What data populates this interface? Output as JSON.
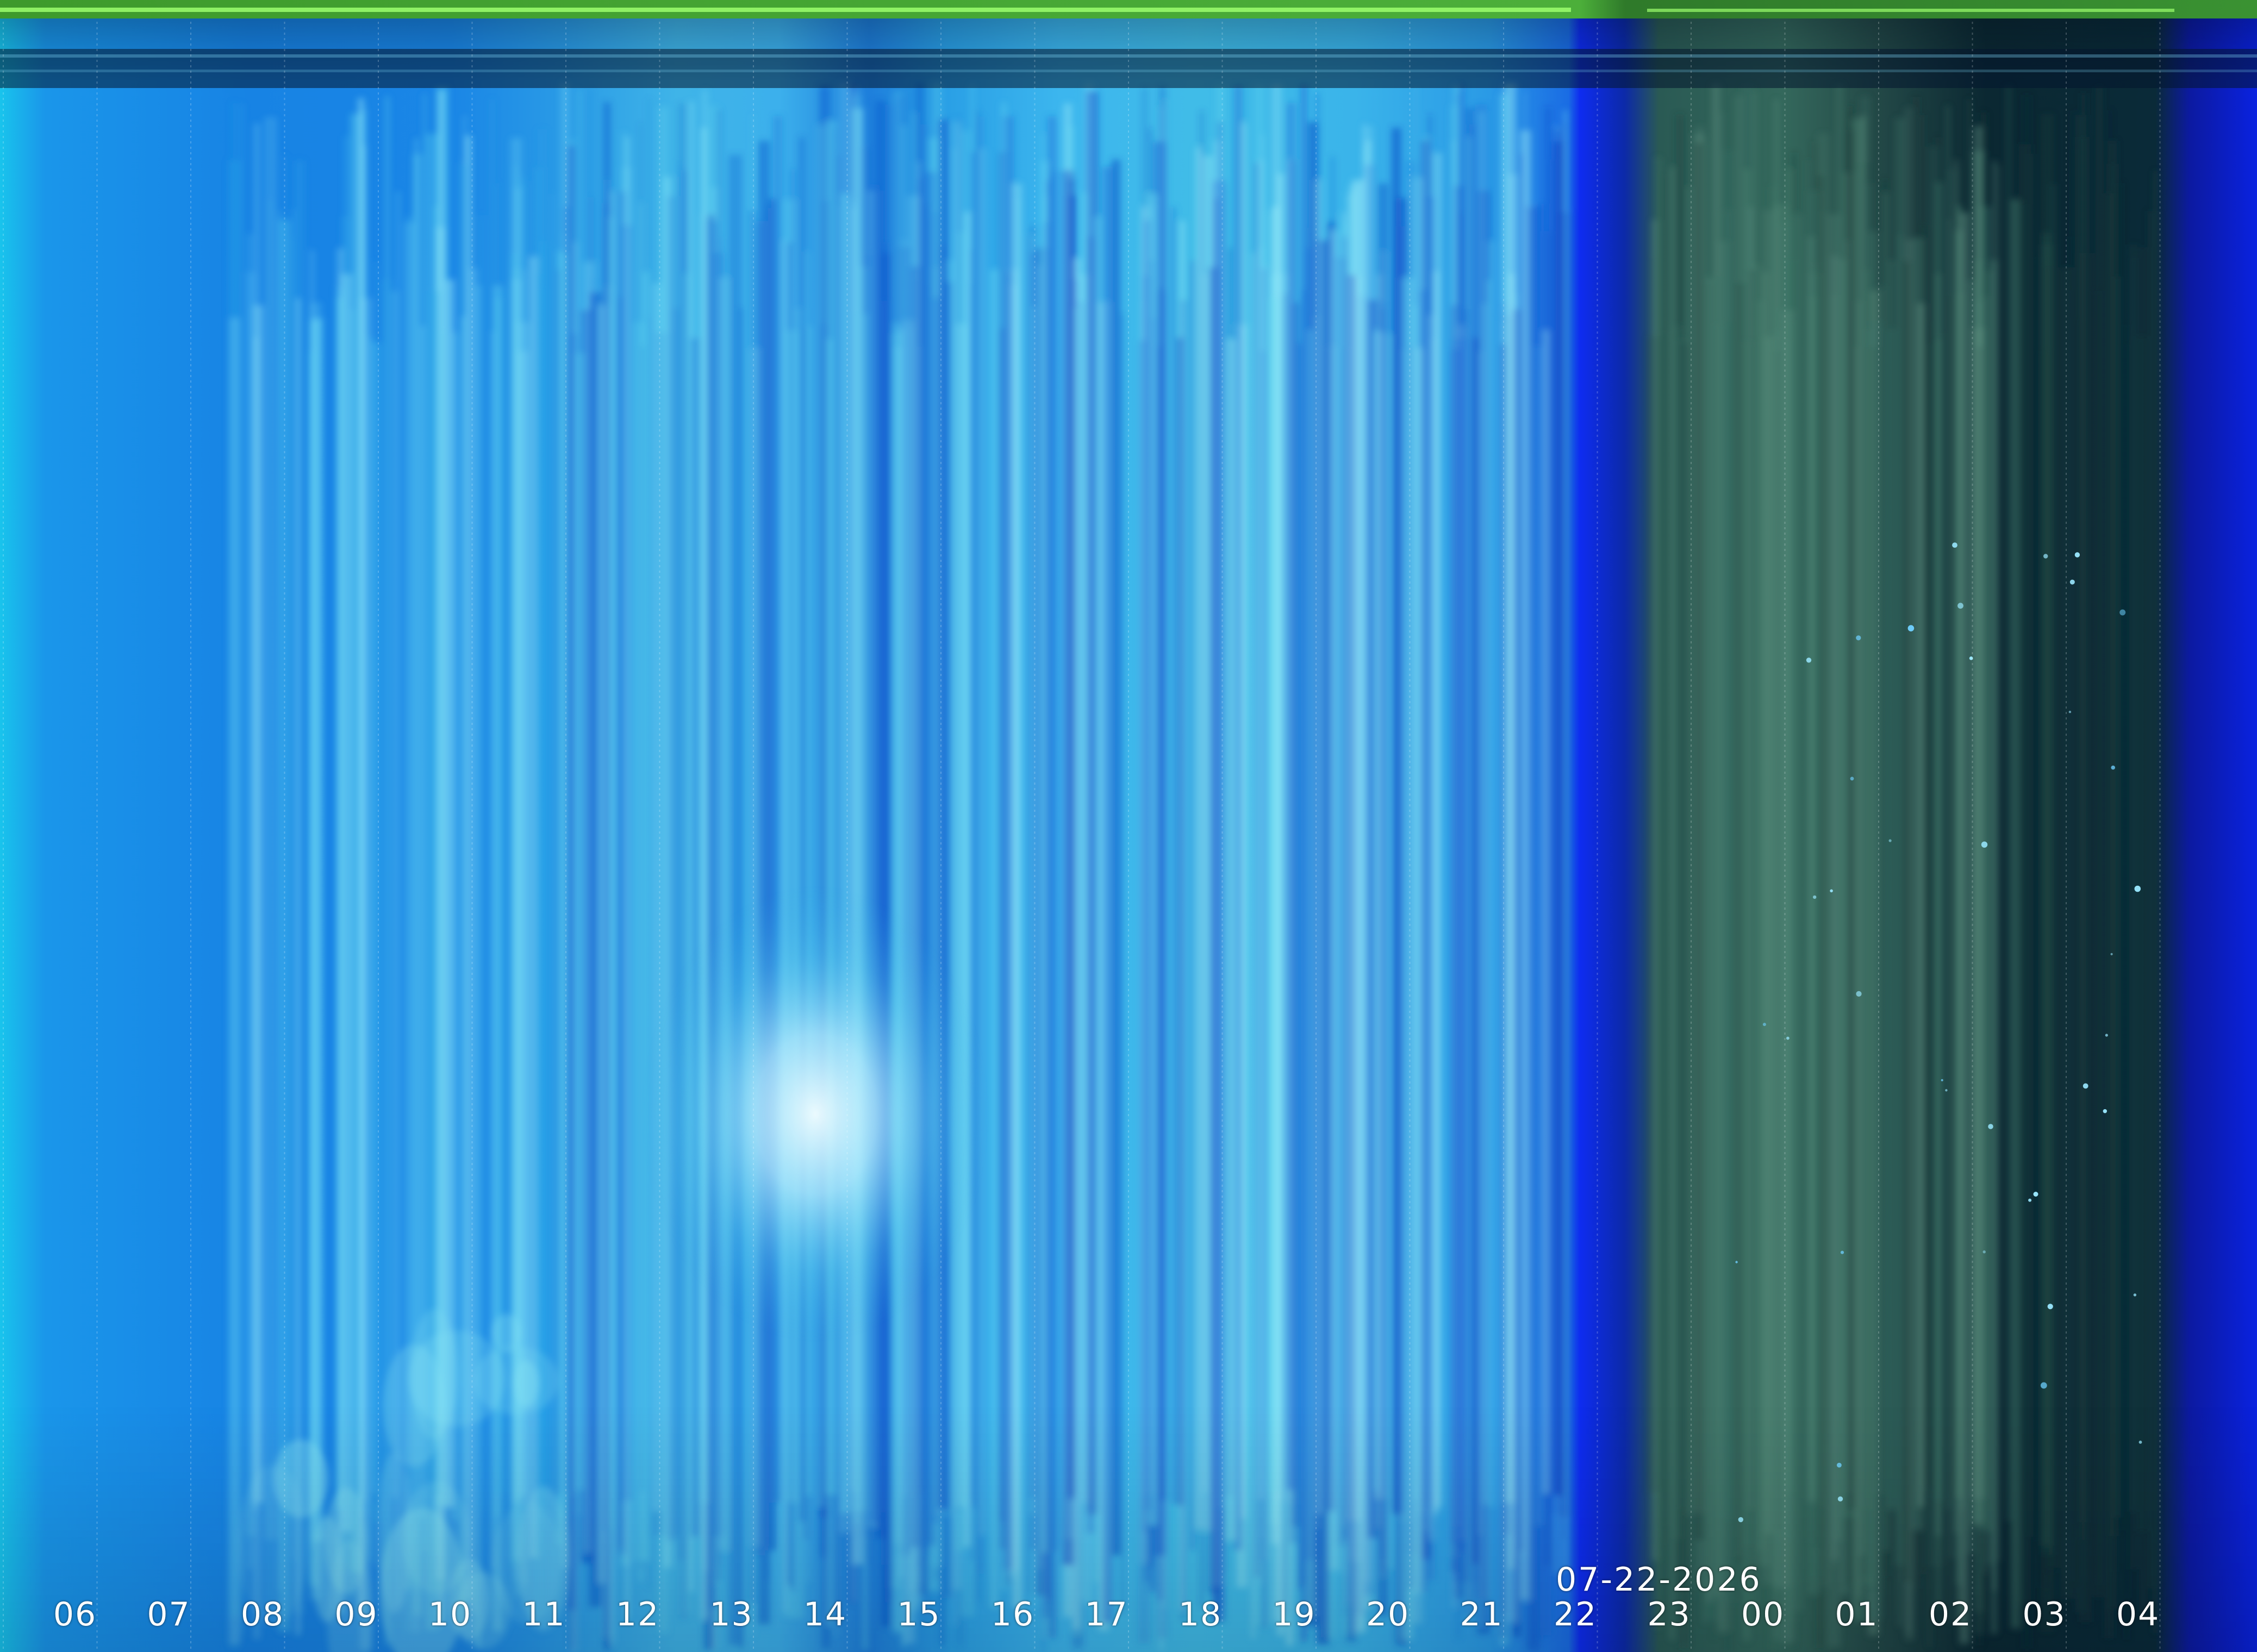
{
  "keogram": {
    "date_label": "07-22-2026",
    "hour_labels": [
      "06",
      "07",
      "08",
      "09",
      "10",
      "11",
      "12",
      "13",
      "14",
      "15",
      "16",
      "17",
      "18",
      "19",
      "20",
      "21",
      "22",
      "23",
      "00",
      "01",
      "02",
      "03",
      "04"
    ],
    "colors": {
      "day_sky": "#1a8fe8",
      "day_bright": "#5fd8f0",
      "sun_glare": "#e8fbff",
      "dusk_blue": "#1030f0",
      "night_teal": "#2a5a50",
      "night_dark": "#0a2430",
      "top_band_green": "#4caf3a"
    }
  }
}
